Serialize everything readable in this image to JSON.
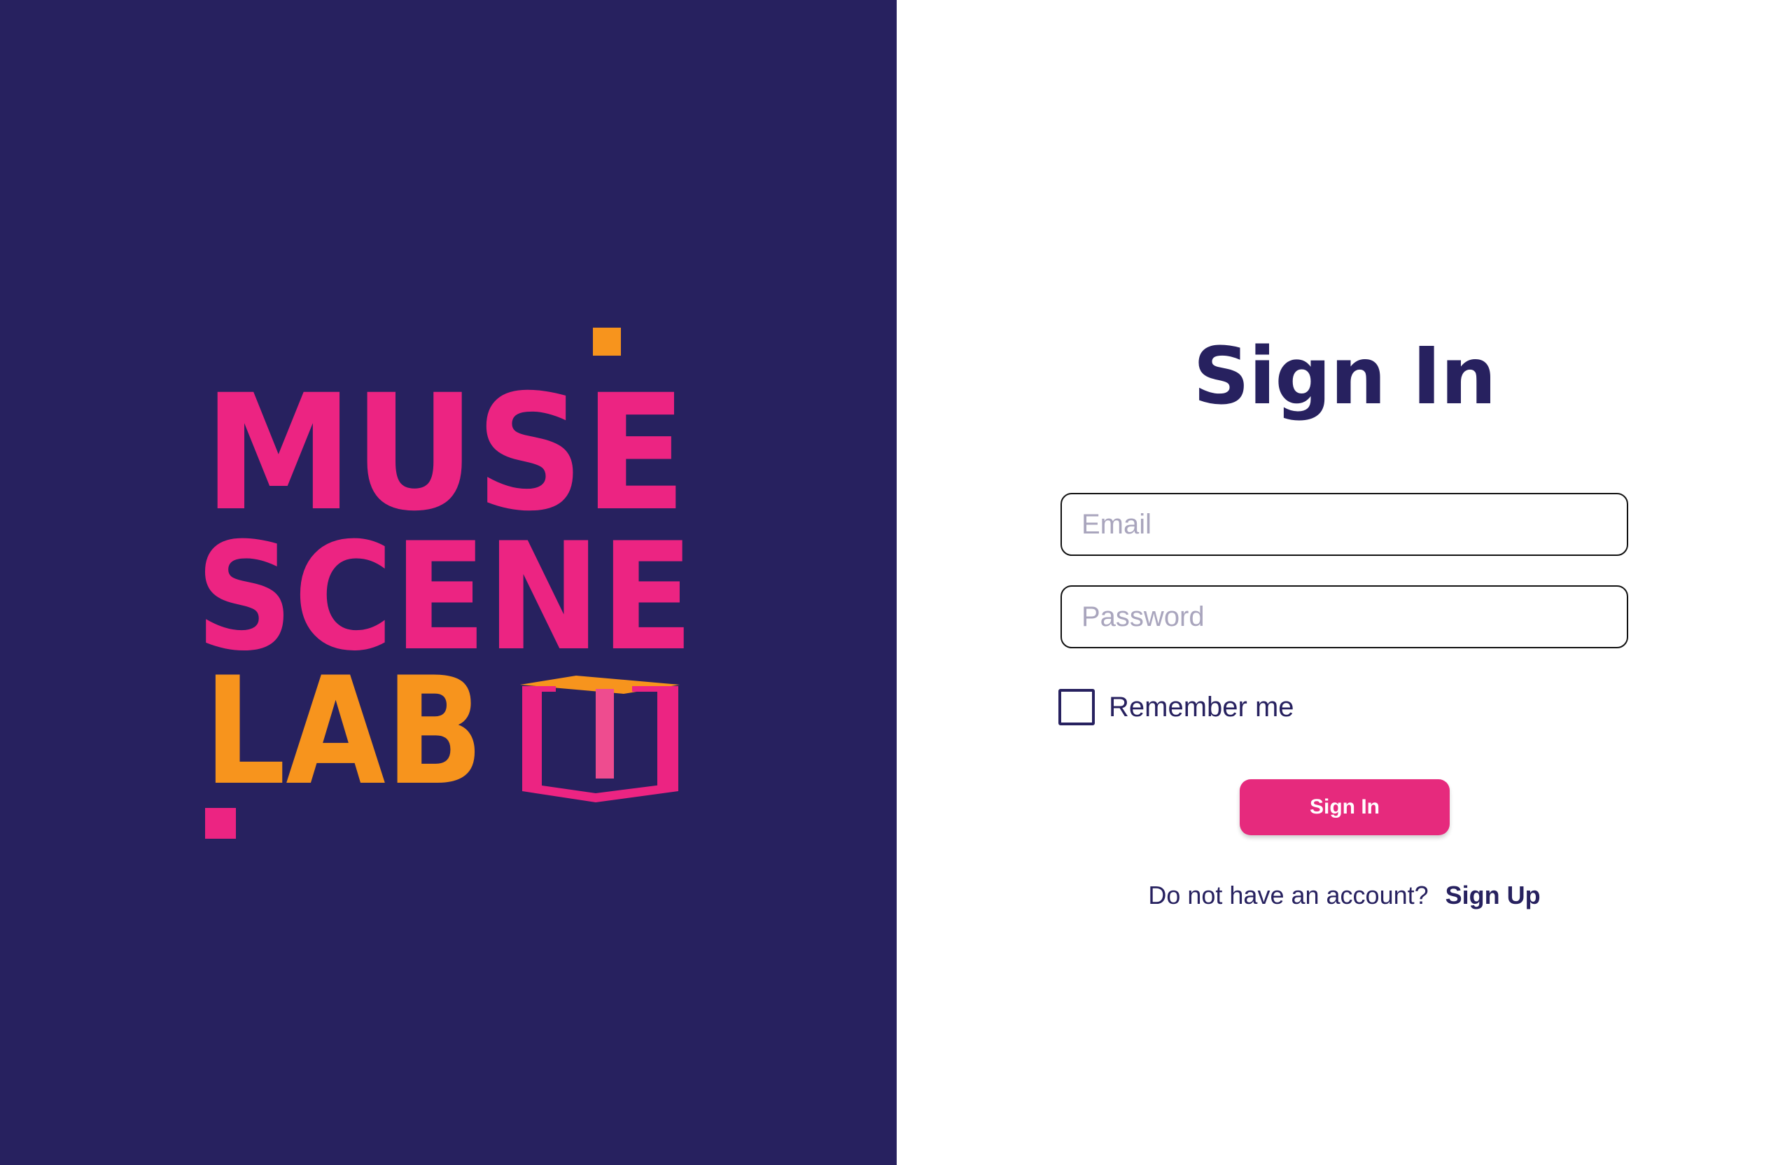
{
  "brand": {
    "logo_lines": [
      "MUSE",
      "SCENE",
      "LAB"
    ],
    "colors": {
      "panel_bg": "#27215f",
      "pink": "#ec2482",
      "orange": "#f7941d"
    }
  },
  "form": {
    "title": "Sign In",
    "email_placeholder": "Email",
    "password_placeholder": "Password",
    "remember_label": "Remember me",
    "submit_label": "Sign In",
    "signup_prompt": "Do not have an account?",
    "signup_link": "Sign Up",
    "accent_color": "#e62a7d"
  }
}
